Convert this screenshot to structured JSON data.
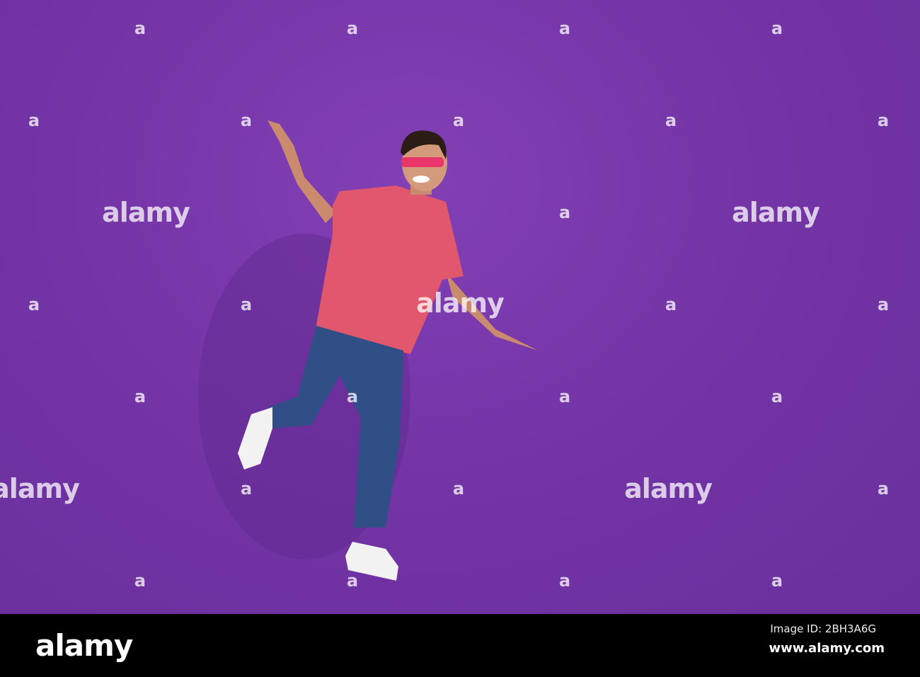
{
  "watermark": {
    "short": "a",
    "word": "alamy"
  },
  "footer": {
    "logo": "alamy",
    "image_id": "Image ID: 2BH3A6G",
    "url": "www.alamy.com"
  },
  "colors": {
    "background": "#7a38ad",
    "shirt": "#e0576e",
    "jeans": "#2f4f86",
    "bar": "#000000"
  }
}
